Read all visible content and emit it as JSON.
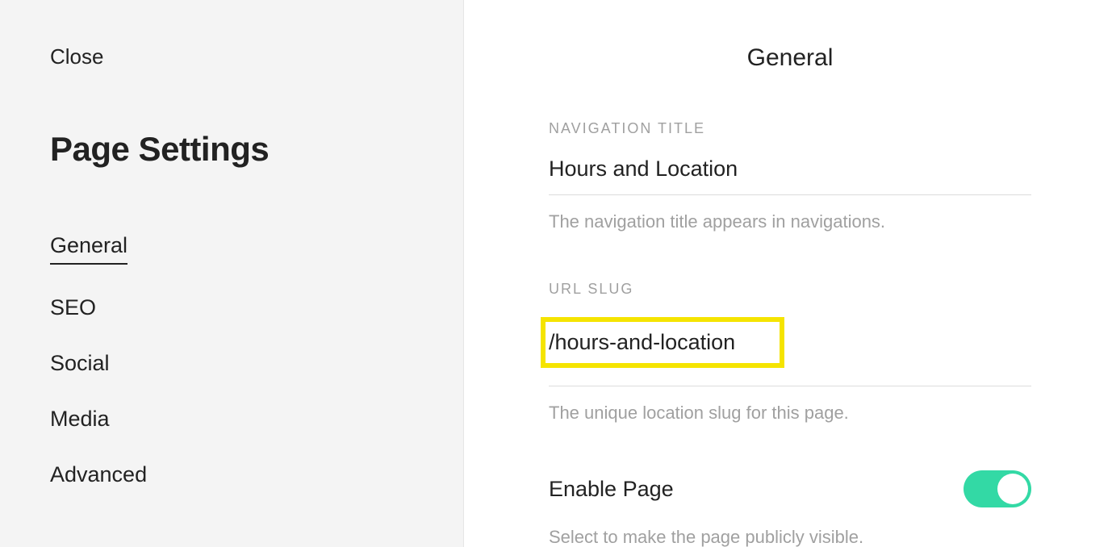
{
  "sidebar": {
    "close_label": "Close",
    "title": "Page Settings",
    "nav": [
      {
        "label": "General",
        "active": true
      },
      {
        "label": "SEO",
        "active": false
      },
      {
        "label": "Social",
        "active": false
      },
      {
        "label": "Media",
        "active": false
      },
      {
        "label": "Advanced",
        "active": false
      }
    ]
  },
  "main": {
    "heading": "General",
    "nav_title": {
      "label": "NAVIGATION TITLE",
      "value": "Hours and Location",
      "help": "The navigation title appears in navigations."
    },
    "url_slug": {
      "label": "URL SLUG",
      "value": "/hours-and-location",
      "help": "The unique location slug for this page."
    },
    "enable_page": {
      "label": "Enable Page",
      "enabled": true,
      "help": "Select to make the page publicly visible."
    }
  }
}
